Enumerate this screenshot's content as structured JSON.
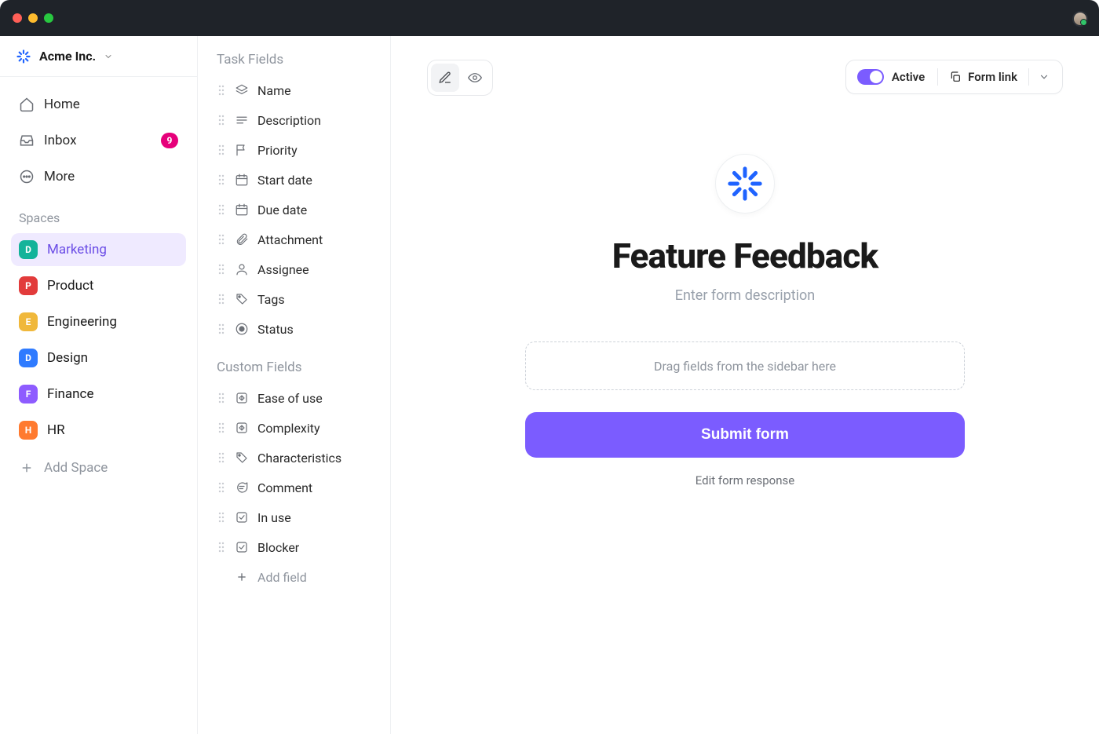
{
  "org": {
    "name": "Acme Inc."
  },
  "nav": {
    "home": "Home",
    "inbox": "Inbox",
    "inbox_badge": "9",
    "more": "More"
  },
  "spaces_label": "Spaces",
  "spaces": [
    {
      "letter": "D",
      "color": "#13b39a",
      "name": "Marketing",
      "active": true
    },
    {
      "letter": "P",
      "color": "#e23b3b",
      "name": "Product"
    },
    {
      "letter": "E",
      "color": "#f0b83b",
      "name": "Engineering"
    },
    {
      "letter": "D",
      "color": "#2f7bff",
      "name": "Design"
    },
    {
      "letter": "F",
      "color": "#8e5cff",
      "name": "Finance"
    },
    {
      "letter": "H",
      "color": "#ff7a2f",
      "name": "HR"
    }
  ],
  "add_space_label": "Add Space",
  "task_fields_label": "Task Fields",
  "task_fields": [
    {
      "icon": "layers",
      "name": "Name"
    },
    {
      "icon": "lines",
      "name": "Description"
    },
    {
      "icon": "flag",
      "name": "Priority"
    },
    {
      "icon": "calendar",
      "name": "Start date"
    },
    {
      "icon": "calendar",
      "name": "Due date"
    },
    {
      "icon": "paperclip",
      "name": "Attachment"
    },
    {
      "icon": "person",
      "name": "Assignee"
    },
    {
      "icon": "tag",
      "name": "Tags"
    },
    {
      "icon": "status",
      "name": "Status"
    }
  ],
  "custom_fields_label": "Custom Fields",
  "custom_fields": [
    {
      "icon": "diamond",
      "name": "Ease of use"
    },
    {
      "icon": "diamond",
      "name": "Complexity"
    },
    {
      "icon": "tag",
      "name": "Characteristics"
    },
    {
      "icon": "comment",
      "name": "Comment"
    },
    {
      "icon": "check",
      "name": "In use"
    },
    {
      "icon": "check",
      "name": "Blocker"
    }
  ],
  "add_field_label": "Add field",
  "toolbar": {
    "active_label": "Active",
    "form_link_label": "Form link"
  },
  "form": {
    "title": "Feature Feedback",
    "description_placeholder": "Enter form description",
    "dropzone_text": "Drag fields from the sidebar here",
    "submit_label": "Submit form",
    "edit_response_label": "Edit form response"
  },
  "colors": {
    "accent": "#7b5cff",
    "logo_blue": "#1f63ff"
  }
}
